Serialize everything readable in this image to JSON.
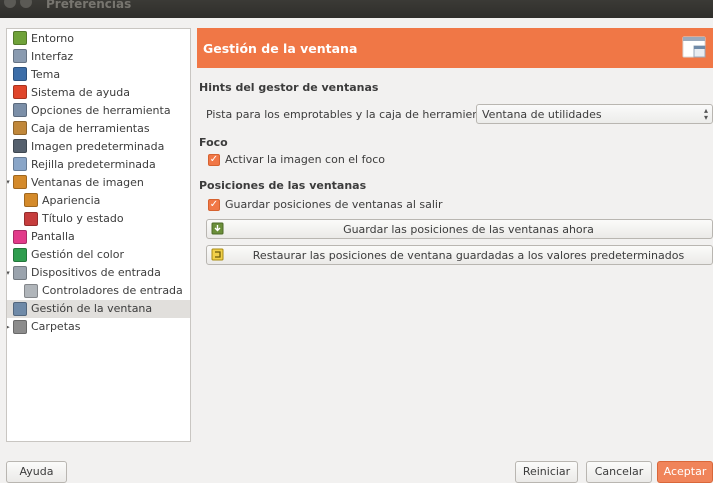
{
  "window": {
    "title": "Preferencias"
  },
  "tree": {
    "items": [
      {
        "label": "Entorno",
        "icon": "environment-icon",
        "color": "#6fa239",
        "expander": ""
      },
      {
        "label": "Interfaz",
        "icon": "interface-icon",
        "color": "#8a9bb0",
        "expander": ""
      },
      {
        "label": "Tema",
        "icon": "theme-icon",
        "color": "#3d6ea8",
        "expander": ""
      },
      {
        "label": "Sistema de ayuda",
        "icon": "help-system-icon",
        "color": "#e0452a",
        "expander": ""
      },
      {
        "label": "Opciones de herramienta",
        "icon": "tool-options-icon",
        "color": "#7b8fa8",
        "expander": ""
      },
      {
        "label": "Caja de herramientas",
        "icon": "toolbox-icon",
        "color": "#c0873a",
        "expander": ""
      },
      {
        "label": "Imagen predeterminada",
        "icon": "default-image-icon",
        "color": "#55606d",
        "expander": ""
      },
      {
        "label": "Rejilla predeterminada",
        "icon": "default-grid-icon",
        "color": "#8aa6c8",
        "expander": ""
      },
      {
        "label": "Ventanas de imagen",
        "icon": "image-windows-icon",
        "color": "#d48a2a",
        "expander": "▾"
      },
      {
        "label": "Apariencia",
        "icon": "appearance-icon",
        "color": "#d48a2a",
        "expander": ""
      },
      {
        "label": "Título y estado",
        "icon": "title-status-icon",
        "color": "#c63d3d",
        "expander": ""
      },
      {
        "label": "Pantalla",
        "icon": "display-icon",
        "color": "#e23b8a",
        "expander": ""
      },
      {
        "label": "Gestión del color",
        "icon": "color-management-icon",
        "color": "#2f9e4f",
        "expander": ""
      },
      {
        "label": "Dispositivos de entrada",
        "icon": "input-devices-icon",
        "color": "#9aa3ad",
        "expander": "▾"
      },
      {
        "label": "Controladores de entrada",
        "icon": "input-controllers-icon",
        "color": "#b0b5ba",
        "expander": ""
      },
      {
        "label": "Gestión de la ventana",
        "icon": "window-management-icon",
        "color": "#6f8aa8",
        "expander": ""
      },
      {
        "label": "Carpetas",
        "icon": "folders-icon",
        "color": "#8c8c8c",
        "expander": "▸"
      }
    ],
    "selected_index": 15
  },
  "panel": {
    "title": "Gestión de la ventana",
    "section_hints": "Hints del gestor de ventanas",
    "hint_label": "Pista para los emprotables y la caja de herramientas:",
    "hint_value": "Ventana de utilidades",
    "section_focus": "Foco",
    "focus_checkbox": "Activar la imagen con el foco",
    "section_positions": "Posiciones de las ventanas",
    "positions_checkbox": "Guardar posiciones de ventanas al salir",
    "save_now_button": "Guardar las posiciones de las ventanas ahora",
    "restore_button": "Restaurar las posiciones de ventana guardadas a los valores predeterminados"
  },
  "buttons": {
    "help": "Ayuda",
    "reset": "Reiniciar",
    "cancel": "Cancelar",
    "ok": "Aceptar"
  },
  "colors": {
    "accent": "#f07746"
  }
}
